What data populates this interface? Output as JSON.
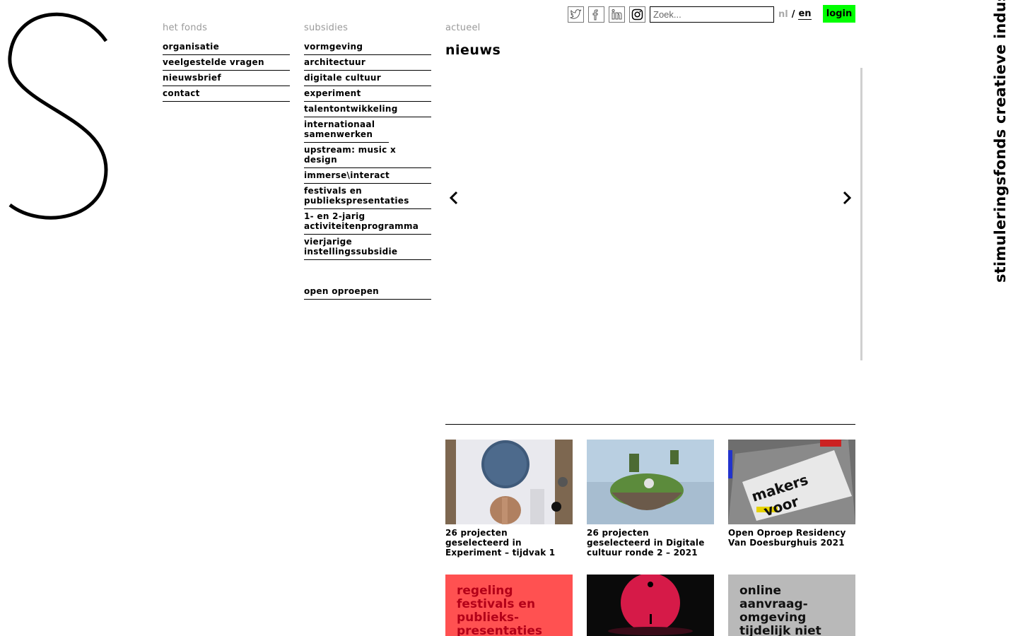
{
  "brand": {
    "vertical_title": "stimuleringsfonds creatieve industrie"
  },
  "topbar": {
    "social": [
      "twitter-icon",
      "facebook-icon",
      "linkedin-icon",
      "instagram-icon"
    ],
    "search_placeholder": "Zoek...",
    "lang_nl": "nl",
    "lang_sep": "/",
    "lang_en": "en",
    "login_label": "login",
    "login_color": "#00ff00"
  },
  "het_fonds": {
    "heading": "het fonds",
    "items": [
      "organisatie",
      "veelgestelde vragen",
      "nieuwsbrief",
      "contact"
    ]
  },
  "subsidies": {
    "heading": "subsidies",
    "items": [
      "vormgeving",
      "architectuur",
      "digitale cultuur",
      "experiment",
      "talentontwikkeling",
      "internationaal samenwerken",
      "upstream: music x design",
      "immerse\\interact",
      "festivals en publiekspresentaties",
      "1- en 2-jarig activiteitenprogramma",
      "vierjarige instellingssubsidie"
    ],
    "extra": "open oproepen"
  },
  "actueel": {
    "heading": "actueel",
    "title": "nieuws"
  },
  "cards": [
    {
      "caption": "26 projecten geselecteerd in Experiment – tijdvak 1"
    },
    {
      "caption": "26 projecten geselecteerd in Digitale cultuur ronde 2 – 2021"
    },
    {
      "caption": "Open Oproep Residency Van Doesburghuis 2021"
    },
    {
      "tile_text": "regeling festivals en publieks-presentaties",
      "tile_color": "#ff4f4f",
      "text_color": "#c8001e"
    },
    {
      "tile_text": ""
    },
    {
      "tile_text": "online aanvraag-omgeving tijdelijk niet beschikbaar",
      "tile_color": "#b9b9b9",
      "text_color": "#111111"
    }
  ]
}
